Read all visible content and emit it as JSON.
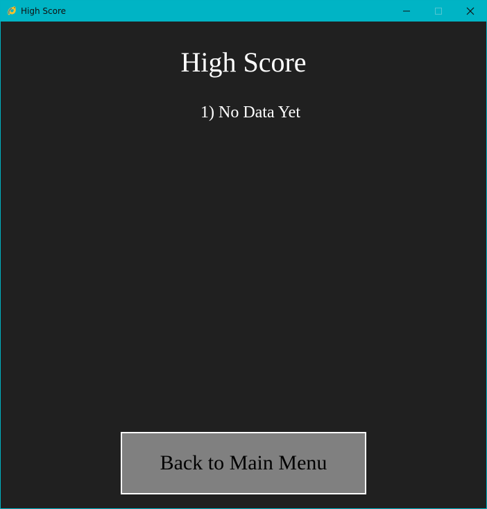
{
  "window": {
    "title": "High Score",
    "icon": "pygame-snake-icon",
    "controls": {
      "minimize_icon": "minimize-icon",
      "maximize_icon": "maximize-icon",
      "close_icon": "close-icon"
    }
  },
  "screen": {
    "heading": "High Score",
    "scores": [
      "1) No Data Yet"
    ],
    "back_button_label": "Back to Main Menu"
  },
  "colors": {
    "title_bar": "#00b4c5",
    "background": "#202020",
    "text": "#ffffff",
    "button_fill": "#808080",
    "button_border": "#ffffff",
    "button_text": "#000000"
  }
}
